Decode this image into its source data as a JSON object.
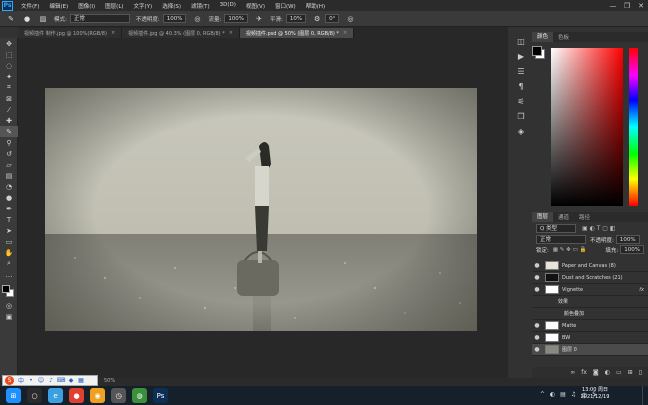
{
  "app": {
    "logo": "Ps"
  },
  "menu": [
    "文件(F)",
    "编辑(E)",
    "图像(I)",
    "图层(L)",
    "文字(Y)",
    "选择(S)",
    "滤镜(T)",
    "3D(D)",
    "视图(V)",
    "窗口(W)",
    "帮助(H)"
  ],
  "window_controls": [
    "—",
    "❐",
    "✕"
  ],
  "options": {
    "mode_label": "模式:",
    "mode_value": "正常",
    "opacity_label": "不透明度:",
    "opacity_value": "100%",
    "flow_label": "流量:",
    "flow_value": "100%",
    "smooth_label": "平滑:",
    "smooth_value": "10%",
    "angle_value": "0°"
  },
  "tabs": [
    {
      "label": "视频插件 制作.jpg @ 100%(RGB/8)",
      "active": false
    },
    {
      "label": "视频插件.jpg @ 40.3% (图层 0, RGB/8) *",
      "active": false
    },
    {
      "label": "视频插件.psd @ 50% (图层 0, RGB/8) *",
      "active": true
    }
  ],
  "color_panel": {
    "tabs": [
      "颜色",
      "色板"
    ],
    "fg": "#000000",
    "bg": "#ffffff",
    "hue": "#ff0000"
  },
  "layers_panel": {
    "tabs": [
      "图层",
      "通道",
      "路径"
    ],
    "kind_label": "Q 类型",
    "blend": "正常",
    "opacity_label": "不透明度:",
    "opacity": "100%",
    "lock_label": "锁定:",
    "fill_label": "填充:",
    "fill": "100%",
    "layers": [
      {
        "name": "Paper and Canvas (8)",
        "fx": false,
        "sel": false,
        "indent": 0
      },
      {
        "name": "Dust and Scratches (21)",
        "fx": false,
        "sel": false,
        "indent": 0
      },
      {
        "name": "Vignette",
        "fx": true,
        "sel": false,
        "indent": 0
      },
      {
        "name": "效果",
        "fx": false,
        "sel": false,
        "indent": 1
      },
      {
        "name": "颜色叠加",
        "fx": false,
        "sel": false,
        "indent": 2
      },
      {
        "name": "Matte",
        "fx": false,
        "sel": false,
        "indent": 0
      },
      {
        "name": "BW",
        "fx": false,
        "sel": false,
        "indent": 0
      },
      {
        "name": "图层 0",
        "fx": false,
        "sel": true,
        "indent": 0
      }
    ],
    "footer_icons": [
      "link-icon",
      "fx-icon",
      "mask-icon",
      "adjust-icon",
      "folder-icon",
      "new-layer-icon",
      "trash-icon"
    ]
  },
  "status": {
    "zoom": "50%"
  },
  "taskbar": {
    "apps": [
      {
        "name": "start",
        "color": "#1e90ff",
        "glyph": "⊞"
      },
      {
        "name": "search",
        "color": "#2a2a2a",
        "glyph": "○"
      },
      {
        "name": "360",
        "color": "#3aa0e0",
        "glyph": "e"
      },
      {
        "name": "chrome",
        "color": "#e04030",
        "glyph": "●"
      },
      {
        "name": "browser",
        "color": "#f0a020",
        "glyph": "◉"
      },
      {
        "name": "clock",
        "color": "#555555",
        "glyph": "◷"
      },
      {
        "name": "wechat",
        "color": "#3a8f3a",
        "glyph": "◍"
      },
      {
        "name": "photoshop",
        "color": "#0c2f55",
        "glyph": "Ps"
      }
    ],
    "time": "13:00 周日",
    "date": "2021/12/19"
  }
}
